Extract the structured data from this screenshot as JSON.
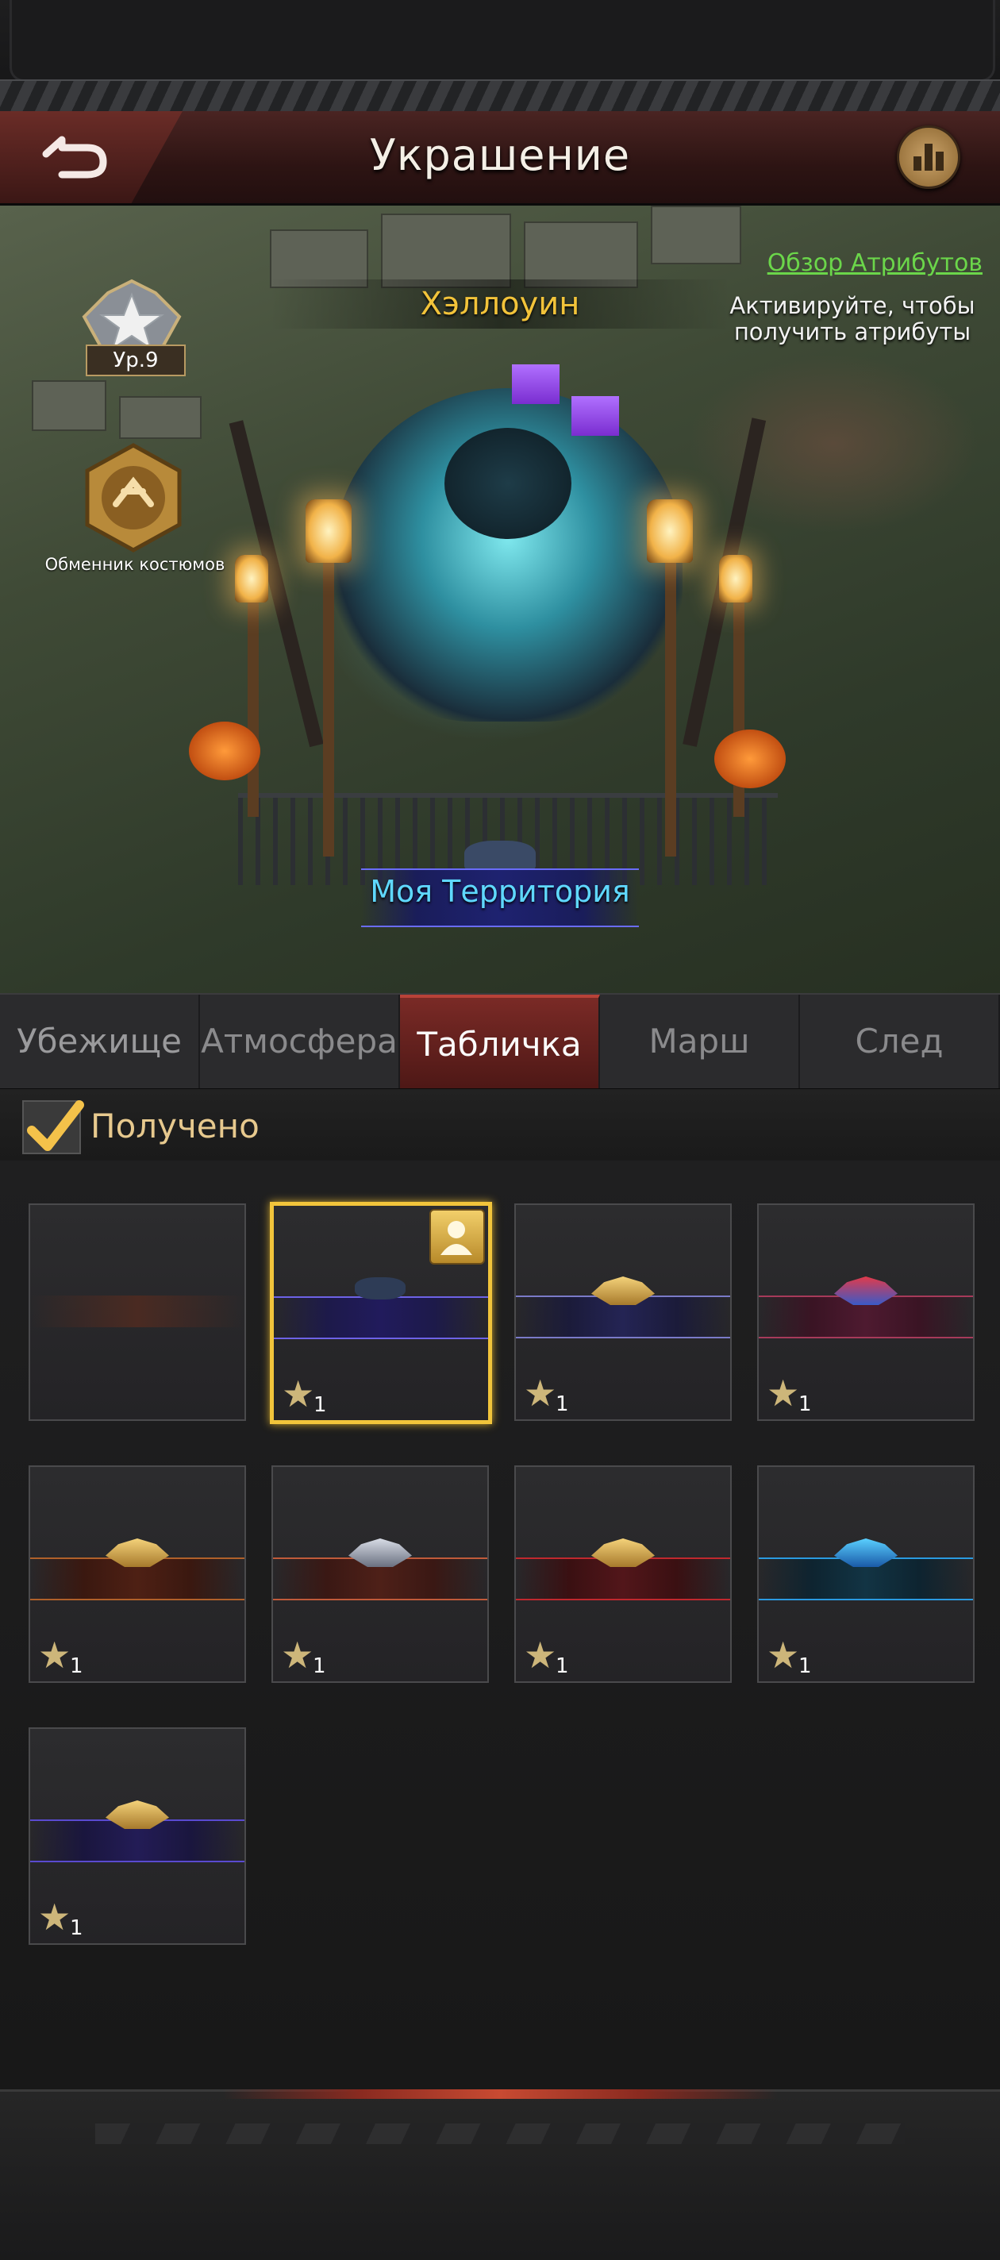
{
  "header": {
    "title": "Украшение"
  },
  "scene": {
    "event_name": "Хэллоуин",
    "attributes_link": "Обзор Атрибутов",
    "attributes_hint": "Активируйте, чтобы получить атрибуты",
    "rank_label": "Ур.9",
    "exchanger_label": "Обменник костюмов",
    "territory_name": "Моя Территория"
  },
  "tabs": [
    {
      "label": "Убежище",
      "active": false
    },
    {
      "label": "Атмосфера",
      "active": false
    },
    {
      "label": "Табличка",
      "active": true
    },
    {
      "label": "Марш",
      "active": false
    },
    {
      "label": "След",
      "active": false
    }
  ],
  "filter": {
    "label": "Получено",
    "checked": true
  },
  "cards": [
    {
      "count": "",
      "selected": false,
      "style": "blank"
    },
    {
      "count": "1",
      "selected": true,
      "style": "purple-cat"
    },
    {
      "count": "1",
      "selected": false,
      "style": "gold-2025"
    },
    {
      "count": "1",
      "selected": false,
      "style": "red-wings"
    },
    {
      "count": "1",
      "selected": false,
      "style": "red-shield"
    },
    {
      "count": "1",
      "selected": false,
      "style": "red-liberty"
    },
    {
      "count": "1",
      "selected": false,
      "style": "red-globe"
    },
    {
      "count": "1",
      "selected": false,
      "style": "blue-tech"
    },
    {
      "count": "1",
      "selected": false,
      "style": "purple-crown"
    }
  ],
  "colors": {
    "accent_gold": "#f1c43b",
    "link_green": "#6bd64a",
    "territory_blue": "#5fd8ff",
    "event_yellow": "#f2c33a",
    "tab_active": "#7a2a26"
  },
  "icons": {
    "back": "back-arrow-icon",
    "stats": "bar-chart-icon",
    "checkbox": "checkmark-icon",
    "owned": "avatar-icon",
    "star": "star-icon"
  }
}
